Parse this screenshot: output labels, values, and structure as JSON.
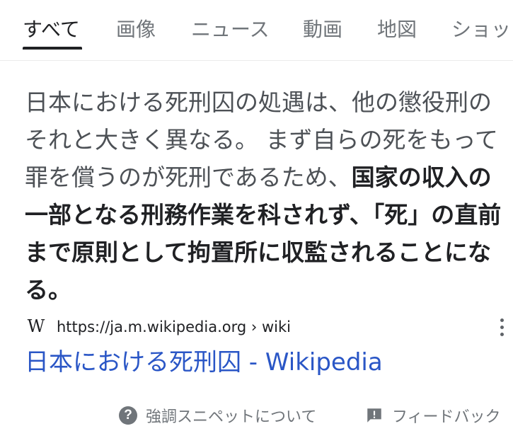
{
  "tabs": [
    {
      "label": "すべて",
      "active": true
    },
    {
      "label": "画像",
      "active": false
    },
    {
      "label": "ニュース",
      "active": false
    },
    {
      "label": "動画",
      "active": false
    },
    {
      "label": "地図",
      "active": false
    },
    {
      "label": "ショッ",
      "active": false
    }
  ],
  "snippet": {
    "plain": "日本における死刑囚の処遇は、他の懲役刑のそれと大きく異なる。 まず自らの死をもって罪を償うのが死刑であるため、",
    "highlight": "国家の収入の一部となる刑務作業を科されず、「死」の直前まで原則として拘置所に収監されることになる。"
  },
  "source": {
    "logo_text": "W",
    "url": "https://ja.m.wikipedia.org › wiki"
  },
  "result": {
    "title": "日本における死刑囚 - Wikipedia"
  },
  "footer": {
    "about_label": "強調スニペットについて",
    "feedback_label": "フィードバック"
  },
  "icons": {
    "help": "help-circle-icon",
    "feedback": "feedback-icon",
    "more": "more-vert-icon"
  },
  "colors": {
    "link": "#2a56c6",
    "text": "#202124",
    "muted": "#70757a"
  }
}
